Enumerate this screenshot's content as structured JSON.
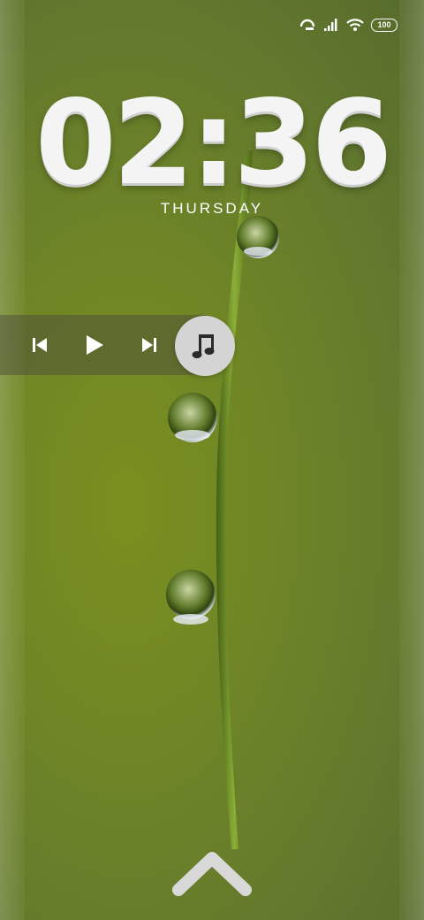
{
  "status_bar": {
    "icons": [
      "signal-refresh-icon",
      "cell-signal-icon",
      "wifi-icon"
    ],
    "battery": "100"
  },
  "lockscreen": {
    "time": "02:36",
    "day": "THURSDAY"
  },
  "music": {
    "prev_icon": "skip-previous-icon",
    "play_icon": "play-icon",
    "next_icon": "skip-next-icon",
    "toggle_icon": "music-note-icon"
  },
  "unlock": {
    "icon": "chevron-up-icon"
  },
  "colors": {
    "accent": "#ffffff",
    "fab_bg": "#d4d4d4",
    "panel_bg": "#46463c"
  }
}
